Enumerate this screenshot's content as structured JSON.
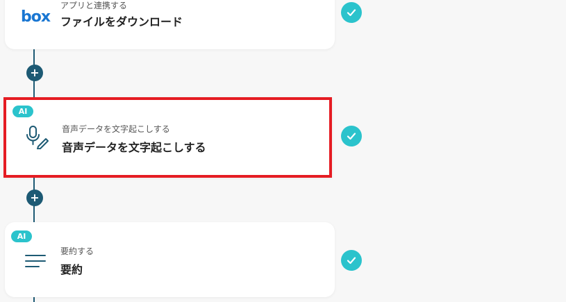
{
  "colors": {
    "connector": "#1d5a74",
    "accent": "#2bc3cc",
    "highlight": "#e51c23",
    "box_brand": "#1976d2"
  },
  "steps": [
    {
      "icon": "box-logo-icon",
      "logo_text": "box",
      "subtitle": "アプリと連携する",
      "title": "ファイルをダウンロード",
      "status": "completed"
    },
    {
      "badge": "AI",
      "icon": "microphone-pen-icon",
      "subtitle": "音声データを文字起こしする",
      "title": "音声データを文字起こしする",
      "status": "completed",
      "highlighted": true
    },
    {
      "badge": "AI",
      "icon": "text-lines-icon",
      "subtitle": "要約する",
      "title": "要約",
      "status": "completed"
    }
  ],
  "add_button_symbol": "+"
}
